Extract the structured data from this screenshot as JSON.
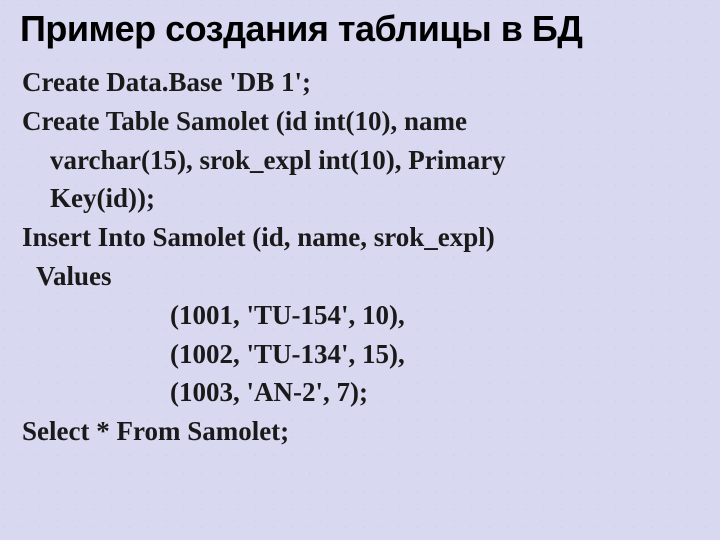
{
  "title": "Пример создания таблицы в БД",
  "lines": {
    "l1": "Create  Data.Base  'DB 1';",
    "l2": "Create  Table  Samolet (id  int(10), name",
    "l3": "varchar(15), srok_expl int(10), Primary",
    "l4": "Key(id));",
    "l5": "Insert  Into  Samolet  (id, name, srok_expl)",
    "l6": "Values",
    "l7": "(1001, 'TU-154', 10),",
    "l8": "(1002, 'TU-134', 15),",
    "l9": "(1003, 'AN-2', 7);",
    "l10": "Select  *  From  Samolet;"
  }
}
